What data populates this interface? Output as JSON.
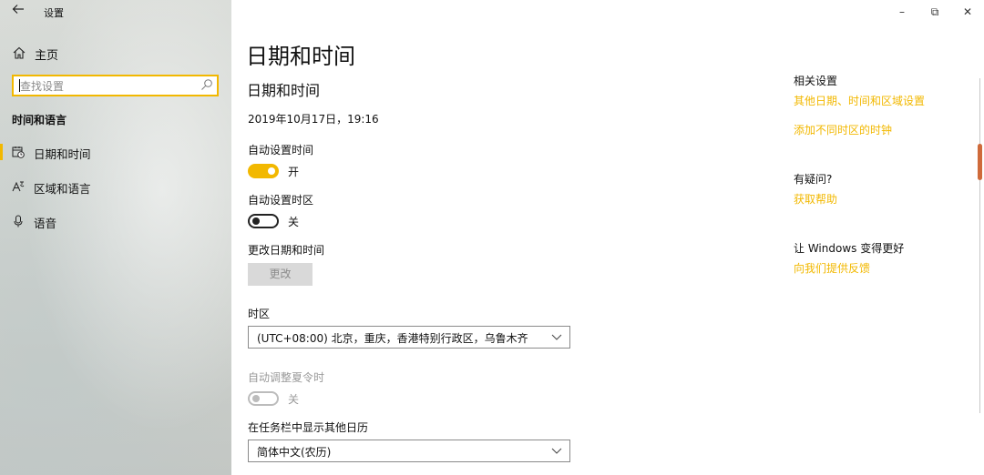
{
  "window": {
    "app_title": "设置",
    "controls": {
      "minimize": "–",
      "restore": "⧉",
      "close": "✕"
    }
  },
  "sidebar": {
    "home_label": "主页",
    "search_placeholder": "查找设置",
    "section_header": "时间和语言",
    "items": [
      {
        "label": "日期和时间",
        "icon": "calendar-clock-icon",
        "active": true
      },
      {
        "label": "区域和语言",
        "icon": "language-icon",
        "active": false
      },
      {
        "label": "语音",
        "icon": "microphone-icon",
        "active": false
      }
    ]
  },
  "main": {
    "page_title": "日期和时间",
    "section_title": "日期和时间",
    "current_datetime": "2019年10月17日，19:16",
    "auto_time": {
      "label": "自动设置时间",
      "state_label": "开",
      "on": true
    },
    "auto_timezone": {
      "label": "自动设置时区",
      "state_label": "关",
      "on": false
    },
    "change_datetime": {
      "label": "更改日期和时间",
      "button": "更改"
    },
    "timezone": {
      "label": "时区",
      "value": "(UTC+08:00) 北京，重庆，香港特别行政区，乌鲁木齐"
    },
    "dst": {
      "label": "自动调整夏令时",
      "state_label": "关",
      "on": false,
      "disabled": true
    },
    "taskbar_calendar": {
      "label": "在任务栏中显示其他日历",
      "value": "简体中文(农历)"
    }
  },
  "related": {
    "header": "相关设置",
    "links": [
      "其他日期、时间和区域设置",
      "添加不同时区的时钟"
    ],
    "help_header": "有疑问?",
    "help_link": "获取帮助",
    "improve_header": "让 Windows 变得更好",
    "feedback_link": "向我们提供反馈"
  },
  "colors": {
    "accent": "#f2b800",
    "focus_border": "#f2b800"
  }
}
